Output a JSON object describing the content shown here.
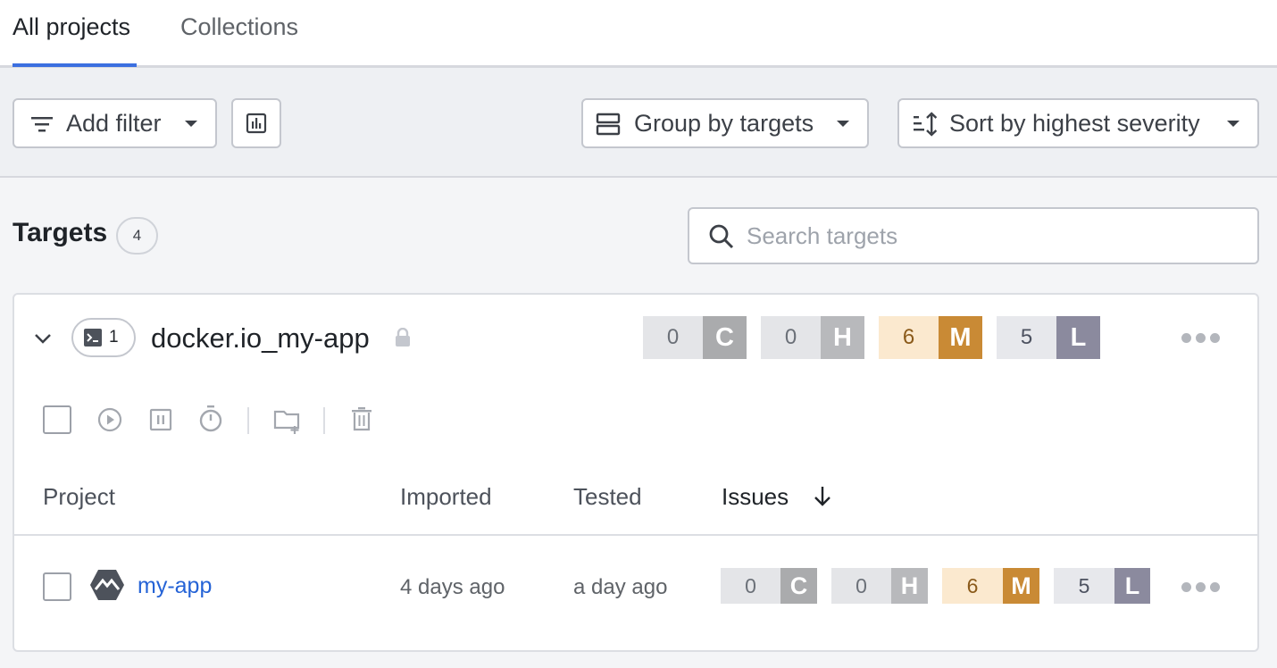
{
  "tabs": [
    {
      "label": "All projects",
      "active": true
    },
    {
      "label": "Collections",
      "active": false
    }
  ],
  "toolbar": {
    "add_filter": "Add filter",
    "group_by": "Group by targets",
    "sort_by": "Sort by highest severity"
  },
  "targets": {
    "title": "Targets",
    "count": "4",
    "search_placeholder": "Search targets"
  },
  "target": {
    "name": "docker.io_my-app",
    "project_count": "1",
    "issues": {
      "critical": {
        "count": "0",
        "letter": "C"
      },
      "high": {
        "count": "0",
        "letter": "H"
      },
      "medium": {
        "count": "6",
        "letter": "M"
      },
      "low": {
        "count": "5",
        "letter": "L"
      }
    }
  },
  "columns": {
    "project": "Project",
    "imported": "Imported",
    "tested": "Tested",
    "issues": "Issues"
  },
  "rows": [
    {
      "name": "my-app",
      "imported": "4 days ago",
      "tested": "a day ago",
      "issues": {
        "critical": {
          "count": "0",
          "letter": "C"
        },
        "high": {
          "count": "0",
          "letter": "H"
        },
        "medium": {
          "count": "6",
          "letter": "M"
        },
        "low": {
          "count": "5",
          "letter": "L"
        }
      }
    }
  ],
  "colors": {
    "accent": "#3b6fe0",
    "link": "#2563d6",
    "critical": "#aaabad",
    "high": "#b8b9bc",
    "medium": "#c98a35",
    "low": "#8b8a9e"
  }
}
